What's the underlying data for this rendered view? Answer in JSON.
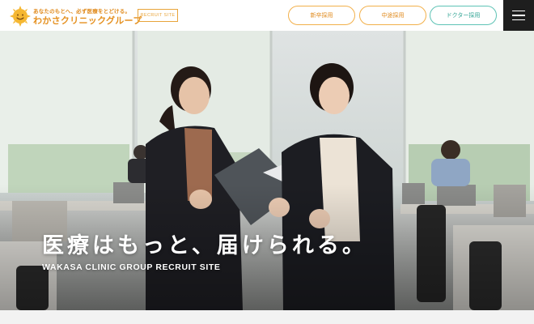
{
  "header": {
    "logo": {
      "tagline": "あなたのもとへ、必ず医療をとどける。",
      "name": "わかさクリニックグループ",
      "icon": "sun-smile-icon"
    },
    "badge": "RECRUIT SITE",
    "nav": {
      "new_grad": "新卒採用",
      "mid_career": "中途採用",
      "doctor": "ドクター採用"
    },
    "menu_icon": "hamburger-menu-icon"
  },
  "hero": {
    "title": "医療はもっと、届けられる。",
    "subtitle": "WAKASA CLINIC GROUP RECRUIT SITE"
  },
  "colors": {
    "brand_orange": "#e5901f",
    "teal": "#2fa393",
    "menu_bg": "#1e1e1e"
  }
}
